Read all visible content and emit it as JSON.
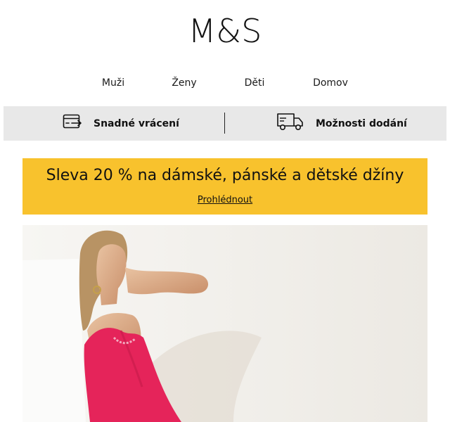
{
  "brand": {
    "logo_text": "M&S"
  },
  "nav": {
    "items": [
      {
        "label": "Muži"
      },
      {
        "label": "Ženy"
      },
      {
        "label": "Děti"
      },
      {
        "label": "Domov"
      }
    ]
  },
  "service_bar": {
    "returns_label": "Snadné vrácení",
    "returns_icon": "card-return-icon",
    "delivery_label": "Možnosti dodání",
    "delivery_icon": "delivery-truck-icon",
    "background": "#e8e8e8"
  },
  "promo": {
    "headline": "Sleva 20 % na dámské, pánské a dětské džíny",
    "link_label": "Prohlédnout",
    "background": "#f8c22d"
  },
  "hero": {
    "image_subject": "woman-in-pink-dress",
    "dress_color": "#e5245a"
  }
}
